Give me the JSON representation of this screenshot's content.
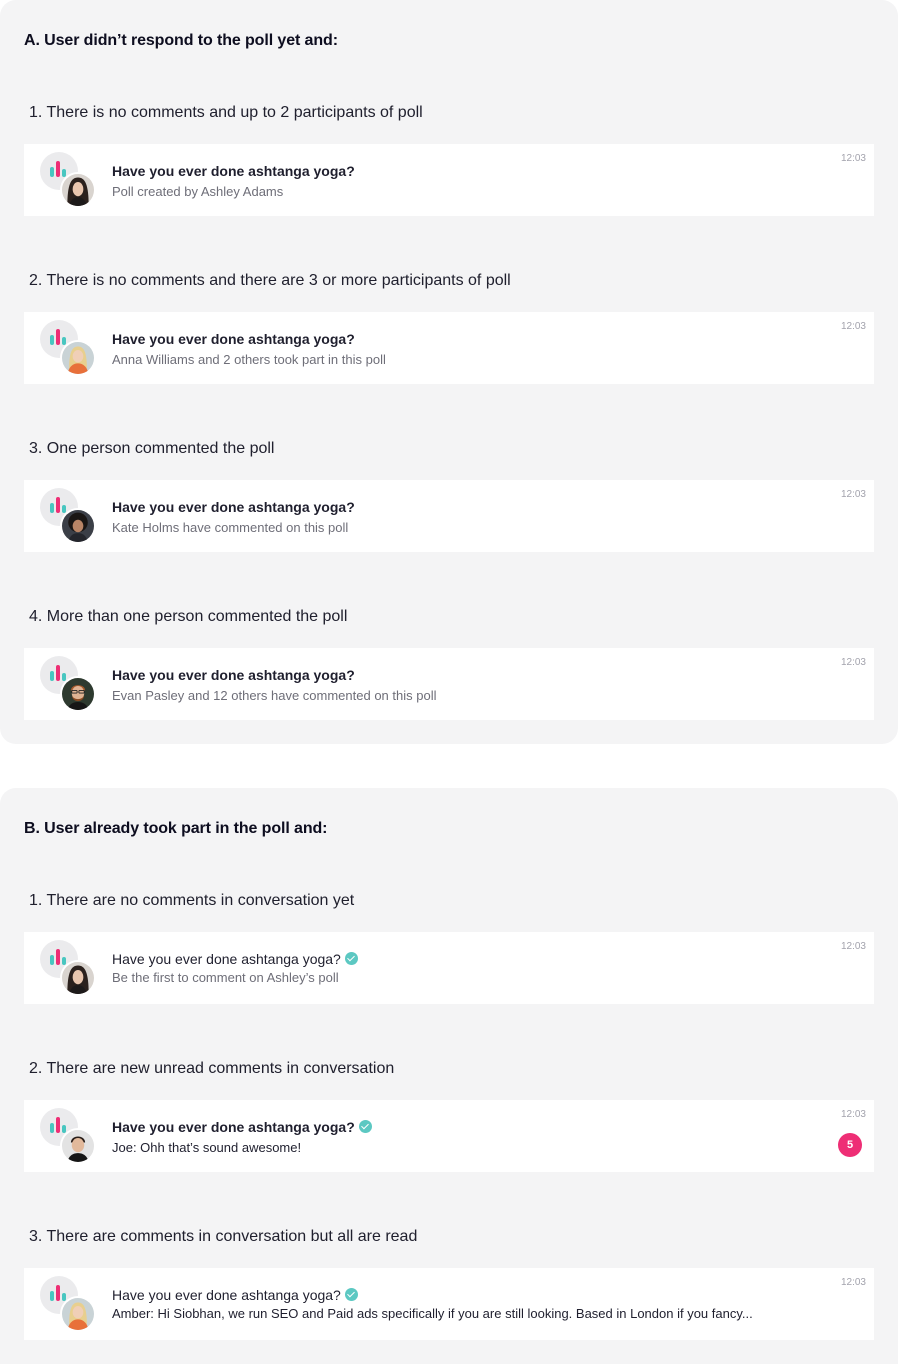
{
  "section_a": {
    "title": "A. User didn’t respond to the poll yet and:",
    "cases": [
      {
        "label": "1. There is no comments and up to 2 participants of poll",
        "question": "Have you ever done ashtanga yoga?",
        "subtitle": "Poll created by Ashley Adams",
        "time": "12:03",
        "avatar": "woman-dark-hair"
      },
      {
        "label": "2. There is no comments and there are 3 or more participants of poll",
        "question": "Have you ever done ashtanga yoga?",
        "subtitle": "Anna Williams and 2 others took part in this poll",
        "time": "12:03",
        "avatar": "woman-blonde-orange"
      },
      {
        "label": "3. One person commented the poll",
        "question": "Have you ever done ashtanga yoga?",
        "subtitle": "Kate Holms have commented on this poll",
        "time": "12:03",
        "avatar": "woman-curly-hair"
      },
      {
        "label": "4. More than one person commented the poll",
        "question": "Have you ever done ashtanga yoga?",
        "subtitle": "Evan Pasley and 12 others have commented on this poll",
        "time": "12:03",
        "avatar": "man-glasses-beard"
      }
    ]
  },
  "section_b": {
    "title": "B. User already took part in the poll and:",
    "cases": [
      {
        "label": "1. There are no comments in conversation yet",
        "question": "Have you ever done ashtanga yoga?",
        "subtitle": "Be the first to comment on Ashley’s poll",
        "time": "12:03",
        "avatar": "woman-dark-hair"
      },
      {
        "label": "2. There are new unread comments in conversation",
        "question": "Have you ever done ashtanga yoga?",
        "subtitle": "Joe: Ohh that’s sound awesome!",
        "time": "12:03",
        "unread_count": "5",
        "avatar": "man-dark-hair"
      },
      {
        "label": "3. There are comments in conversation but all are read",
        "question": "Have you ever done ashtanga yoga?",
        "subtitle": "Amber: Hi Siobhan, we run SEO and Paid ads specifically if you are still  looking. Based in London if you fancy...",
        "time": "12:03",
        "avatar": "woman-blonde-orange"
      }
    ]
  },
  "colors": {
    "panel_bg": "#f4f4f5",
    "poll_pink": "#ee2e75",
    "poll_teal": "#48c6c0",
    "check_teal": "#5cc8c2",
    "badge_pink": "#ee2e75"
  },
  "icons": [
    "poll-chart-icon",
    "check-icon"
  ]
}
